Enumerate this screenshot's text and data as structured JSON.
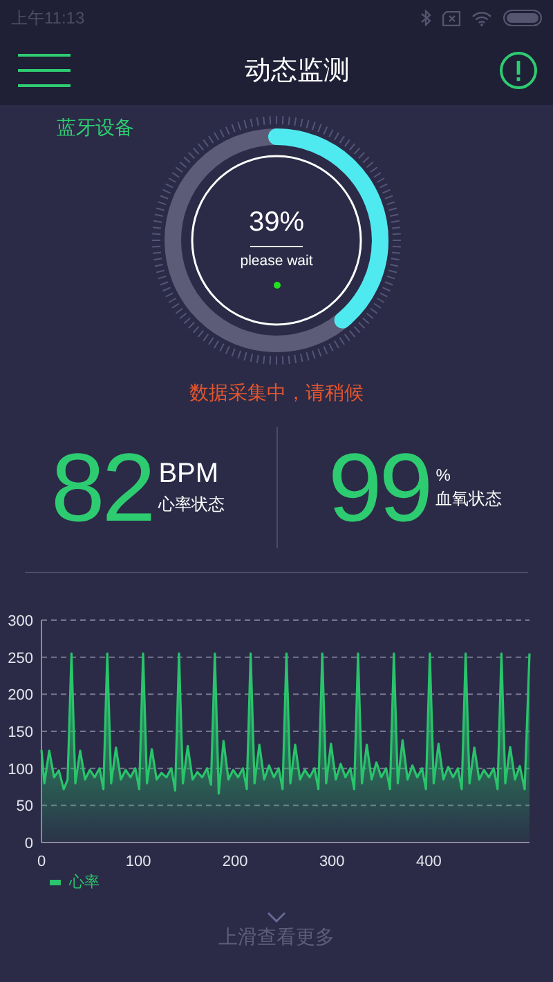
{
  "status_bar": {
    "time": "上午11:13"
  },
  "header": {
    "title": "动态监测"
  },
  "device_label": "蓝牙设备",
  "gauge": {
    "level": 0.39,
    "percent": "39%",
    "caption": "please wait"
  },
  "status_message": "数据采集中，请稍候",
  "stats": [
    {
      "value": "82",
      "unit": "BPM",
      "label": "心率状态"
    },
    {
      "value": "99",
      "unit": "%",
      "label": "血氧状态"
    }
  ],
  "chart": {
    "chart_data": {
      "type": "area",
      "grid": true,
      "xlim": [
        0,
        504
      ],
      "ylim": [
        0,
        300
      ],
      "xticks": [
        0,
        100,
        200,
        300,
        400
      ],
      "yticks": [
        0,
        50,
        100,
        150,
        200,
        250,
        300
      ],
      "x": [
        0,
        3,
        8,
        13,
        18,
        23,
        27,
        31,
        35,
        40,
        45,
        50,
        55,
        60,
        64,
        68,
        72,
        77,
        82,
        87,
        92,
        97,
        101,
        105,
        109,
        114,
        119,
        124,
        129,
        134,
        138,
        142,
        146,
        151,
        156,
        161,
        166,
        171,
        175,
        179,
        183,
        188,
        193,
        198,
        203,
        208,
        212,
        216,
        220,
        225,
        230,
        235,
        240,
        245,
        249,
        253,
        257,
        262,
        267,
        272,
        277,
        282,
        286,
        290,
        294,
        299,
        304,
        309,
        314,
        319,
        323,
        327,
        331,
        336,
        341,
        346,
        351,
        356,
        360,
        364,
        368,
        373,
        378,
        383,
        388,
        393,
        397,
        401,
        405,
        410,
        415,
        420,
        425,
        430,
        434,
        438,
        442,
        447,
        452,
        457,
        462,
        467,
        471,
        475,
        479,
        484,
        489,
        494,
        499,
        504
      ],
      "series": [
        {
          "name": "心率",
          "color": "#29c46b",
          "values": [
            125,
            80,
            124,
            88,
            97,
            72,
            85,
            255,
            80,
            124,
            85,
            98,
            88,
            100,
            72,
            255,
            80,
            128,
            85,
            98,
            88,
            100,
            72,
            255,
            80,
            126,
            85,
            94,
            88,
            100,
            70,
            255,
            80,
            130,
            85,
            95,
            88,
            100,
            78,
            255,
            66,
            137,
            85,
            98,
            88,
            100,
            72,
            255,
            80,
            132,
            85,
            104,
            88,
            100,
            72,
            255,
            80,
            132,
            85,
            98,
            88,
            100,
            72,
            255,
            80,
            133,
            85,
            106,
            88,
            100,
            72,
            255,
            80,
            132,
            85,
            108,
            88,
            100,
            72,
            255,
            80,
            138,
            85,
            104,
            88,
            100,
            72,
            255,
            80,
            133,
            85,
            102,
            88,
            100,
            72,
            255,
            80,
            128,
            85,
            98,
            88,
            100,
            72,
            255,
            80,
            129,
            85,
            103,
            72,
            255
          ]
        }
      ]
    }
  },
  "footer_hint": "上滑查看更多"
}
